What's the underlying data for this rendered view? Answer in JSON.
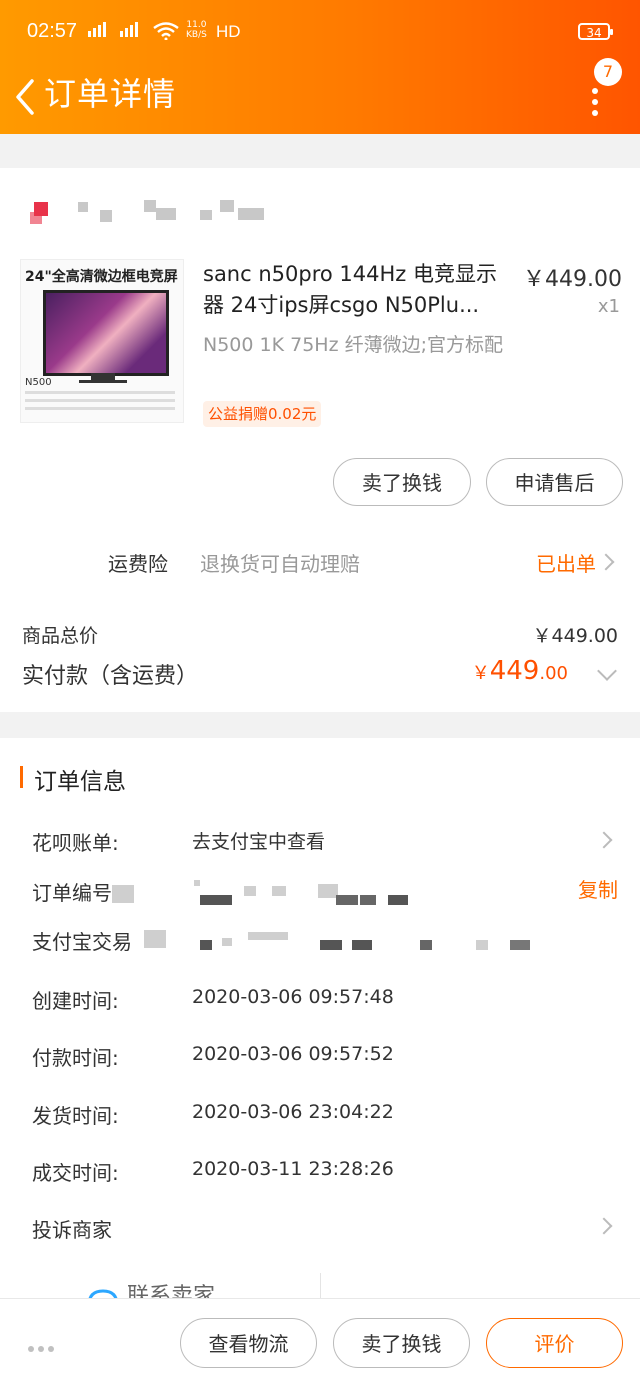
{
  "status_bar": {
    "time": "02:57",
    "network_speed": "11.0",
    "network_unit": "KB/S",
    "hd": "HD",
    "battery": "34"
  },
  "nav": {
    "title": "订单详情",
    "badge_count": "7"
  },
  "product": {
    "thumb_title": "24\"全高清微边框电竞屏",
    "thumb_model": "N500",
    "name": "sanc n50pro 144Hz 电竞显示器 24寸ips屏csgo N50Plu...",
    "variant": "N500 1K 75Hz 纤薄微边;官方标配",
    "tag": "公益捐赠0.02元",
    "price": "￥449.00",
    "qty": "x1",
    "sell_button": "卖了换钱",
    "aftersale_button": "申请售后"
  },
  "insurance": {
    "label": "运费险",
    "desc": "退换货可自动理赔",
    "status": "已出单"
  },
  "totals": {
    "goods_label": "商品总价",
    "goods_value": "￥449.00",
    "paid_label": "实付款（含运费）",
    "paid_currency": "￥",
    "paid_int": "449",
    "paid_dec": ".00"
  },
  "order_info": {
    "section_title": "订单信息",
    "huabei_label": "花呗账单:",
    "huabei_value": "去支付宝中查看",
    "order_no_label": "订单编号",
    "copy": "复制",
    "alipay_label": "支付宝交易",
    "created_label": "创建时间:",
    "created_value": "2020-03-06 09:57:48",
    "paid_label": "付款时间:",
    "paid_value": "2020-03-06 09:57:52",
    "shipped_label": "发货时间:",
    "shipped_value": "2020-03-06 23:04:22",
    "done_label": "成交时间:",
    "done_value": "2020-03-11 23:28:26",
    "complain_label": "投诉商家",
    "contact_label": "联系卖家"
  },
  "bottom_bar": {
    "logistics": "查看物流",
    "sell": "卖了换钱",
    "rate": "评价"
  },
  "colors": {
    "accent": "#ff6a00",
    "price": "#ff5000"
  }
}
